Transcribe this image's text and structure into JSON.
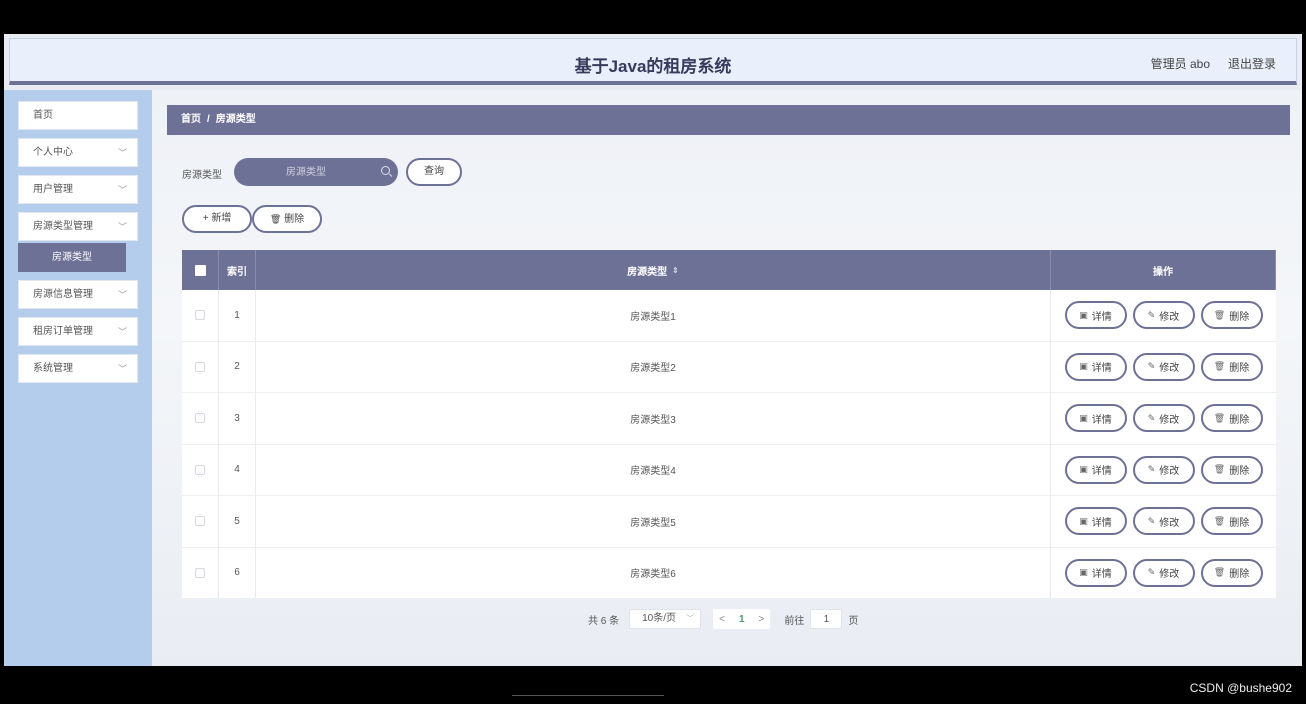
{
  "header": {
    "title": "基于Java的租房系统",
    "user": "管理员 abo",
    "logout": "退出登录"
  },
  "sidebar": {
    "items": [
      {
        "label": "首页",
        "chevron": false
      },
      {
        "label": "个人中心",
        "chevron": true
      },
      {
        "label": "用户管理",
        "chevron": true
      },
      {
        "label": "房源类型管理",
        "chevron": true,
        "sub": "房源类型"
      },
      {
        "label": "房源信息管理",
        "chevron": true
      },
      {
        "label": "租房订单管理",
        "chevron": true
      },
      {
        "label": "系统管理",
        "chevron": true
      }
    ],
    "chevron_glyph": "﹀"
  },
  "breadcrumb": {
    "home": "首页",
    "separator": "/",
    "current": "房源类型"
  },
  "search": {
    "label": "房源类型",
    "placeholder": "房源类型",
    "query_button": "查询"
  },
  "toolbar": {
    "add_label": "新增",
    "add_icon": "+",
    "delete_label": "删除",
    "delete_icon": "🗑"
  },
  "table": {
    "columns": {
      "index": "索引",
      "type": "房源类型",
      "ops": "操作"
    },
    "sort_icon": "⇕",
    "rows": [
      {
        "index": "1",
        "type": "房源类型1"
      },
      {
        "index": "2",
        "type": "房源类型2"
      },
      {
        "index": "3",
        "type": "房源类型3"
      },
      {
        "index": "4",
        "type": "房源类型4"
      },
      {
        "index": "5",
        "type": "房源类型5"
      },
      {
        "index": "6",
        "type": "房源类型6"
      }
    ],
    "row_ops": {
      "detail": "详情",
      "edit": "修改",
      "delete": "删除"
    },
    "row_op_icons": {
      "detail": "▣",
      "edit": "✎",
      "delete": "🗑"
    }
  },
  "pagination": {
    "total": "共 6 条",
    "page_size": "10条/页",
    "prev": "<",
    "current": "1",
    "next": ">",
    "goto_label": "前往",
    "goto_value": "1",
    "page_unit": "页"
  },
  "watermark": "CSDN @bushe902",
  "colors": {
    "accent": "#6e7196",
    "sidebar": "#b4cdec",
    "header_bg": "#e9f0fb"
  }
}
